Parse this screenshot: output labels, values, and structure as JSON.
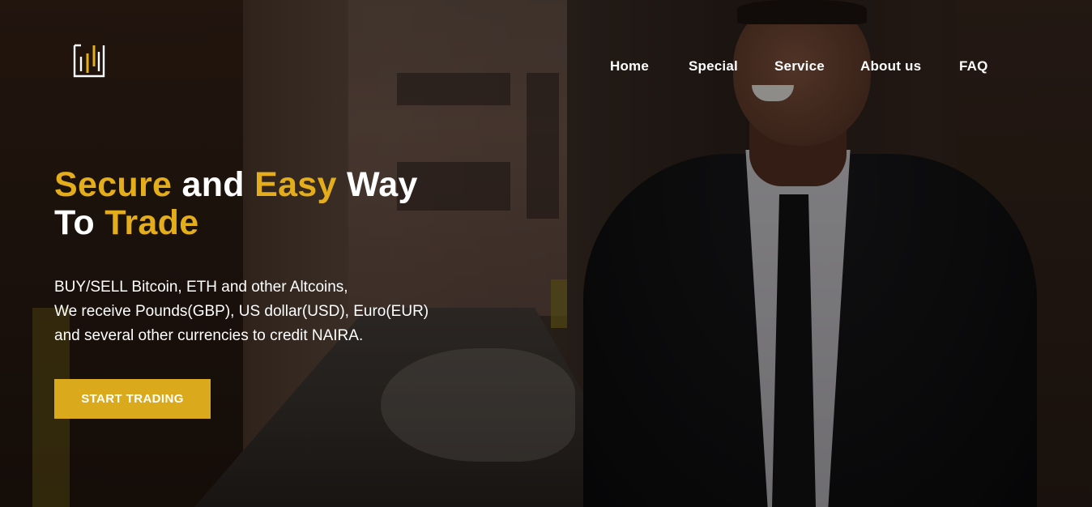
{
  "brand": {
    "logo_icon": "candlestick-chart-logo-icon",
    "accent_color": "#dba91c"
  },
  "nav": {
    "items": [
      {
        "label": "Home"
      },
      {
        "label": "Special"
      },
      {
        "label": "Service"
      },
      {
        "label": "About us"
      },
      {
        "label": "FAQ"
      }
    ]
  },
  "hero": {
    "headline": {
      "word1": "Secure",
      "word2": "and",
      "word3": "Easy",
      "word4": "Way",
      "word5": "To",
      "word6": "Trade"
    },
    "lines": [
      "BUY/SELL Bitcoin, ETH and other Altcoins,",
      "We receive Pounds(GBP), US dollar(USD), Euro(EUR)",
      "and several other currencies to credit NAIRA."
    ],
    "cta_label": "START TRADING"
  }
}
